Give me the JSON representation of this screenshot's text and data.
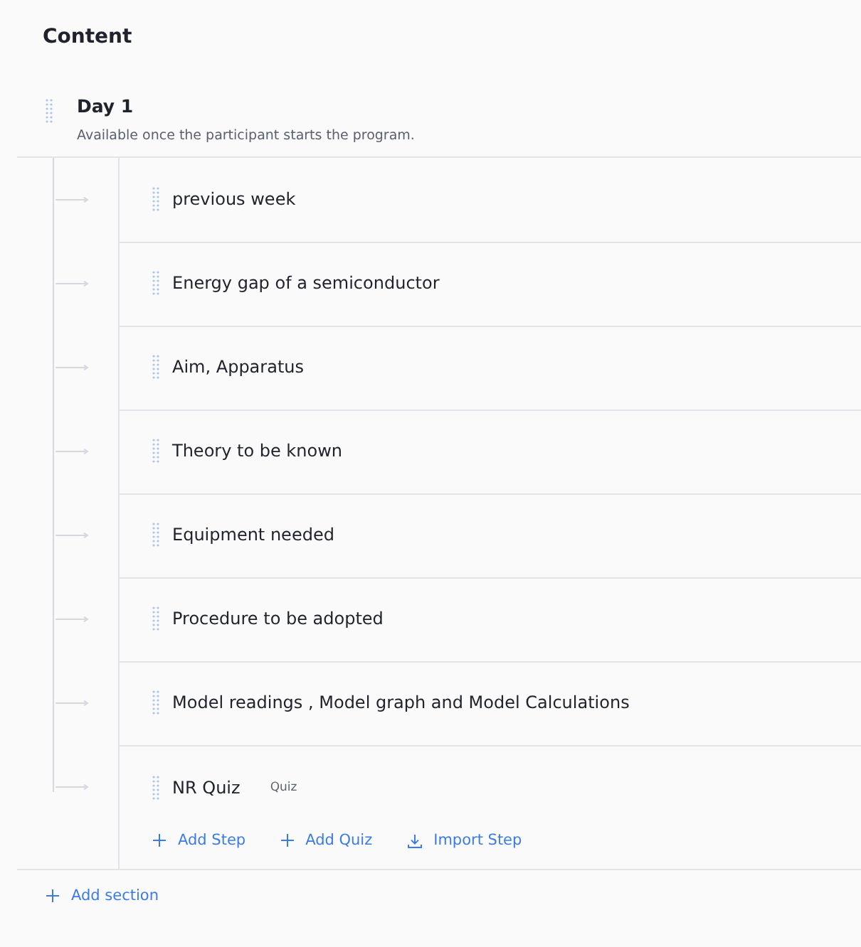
{
  "title": "Content",
  "section": {
    "name": "Day 1",
    "description": "Available once the participant starts the program.",
    "steps": [
      {
        "title": "previous week",
        "kind": "step"
      },
      {
        "title": "Energy gap of a semiconductor",
        "kind": "step"
      },
      {
        "title": "Aim, Apparatus",
        "kind": "step"
      },
      {
        "title": "Theory to be known",
        "kind": "step"
      },
      {
        "title": "Equipment needed",
        "kind": "step"
      },
      {
        "title": "Procedure to be adopted",
        "kind": "step"
      },
      {
        "title": "Model readings , Model graph and Model Calculations",
        "kind": "step"
      },
      {
        "title": "NR Quiz",
        "kind": "quiz",
        "tag": "Quiz"
      }
    ],
    "actions": [
      {
        "label": "Add Step",
        "kind": "add"
      },
      {
        "label": "Add Quiz",
        "kind": "add"
      },
      {
        "label": "Import Step",
        "kind": "import"
      }
    ]
  },
  "add_section": "Add section"
}
